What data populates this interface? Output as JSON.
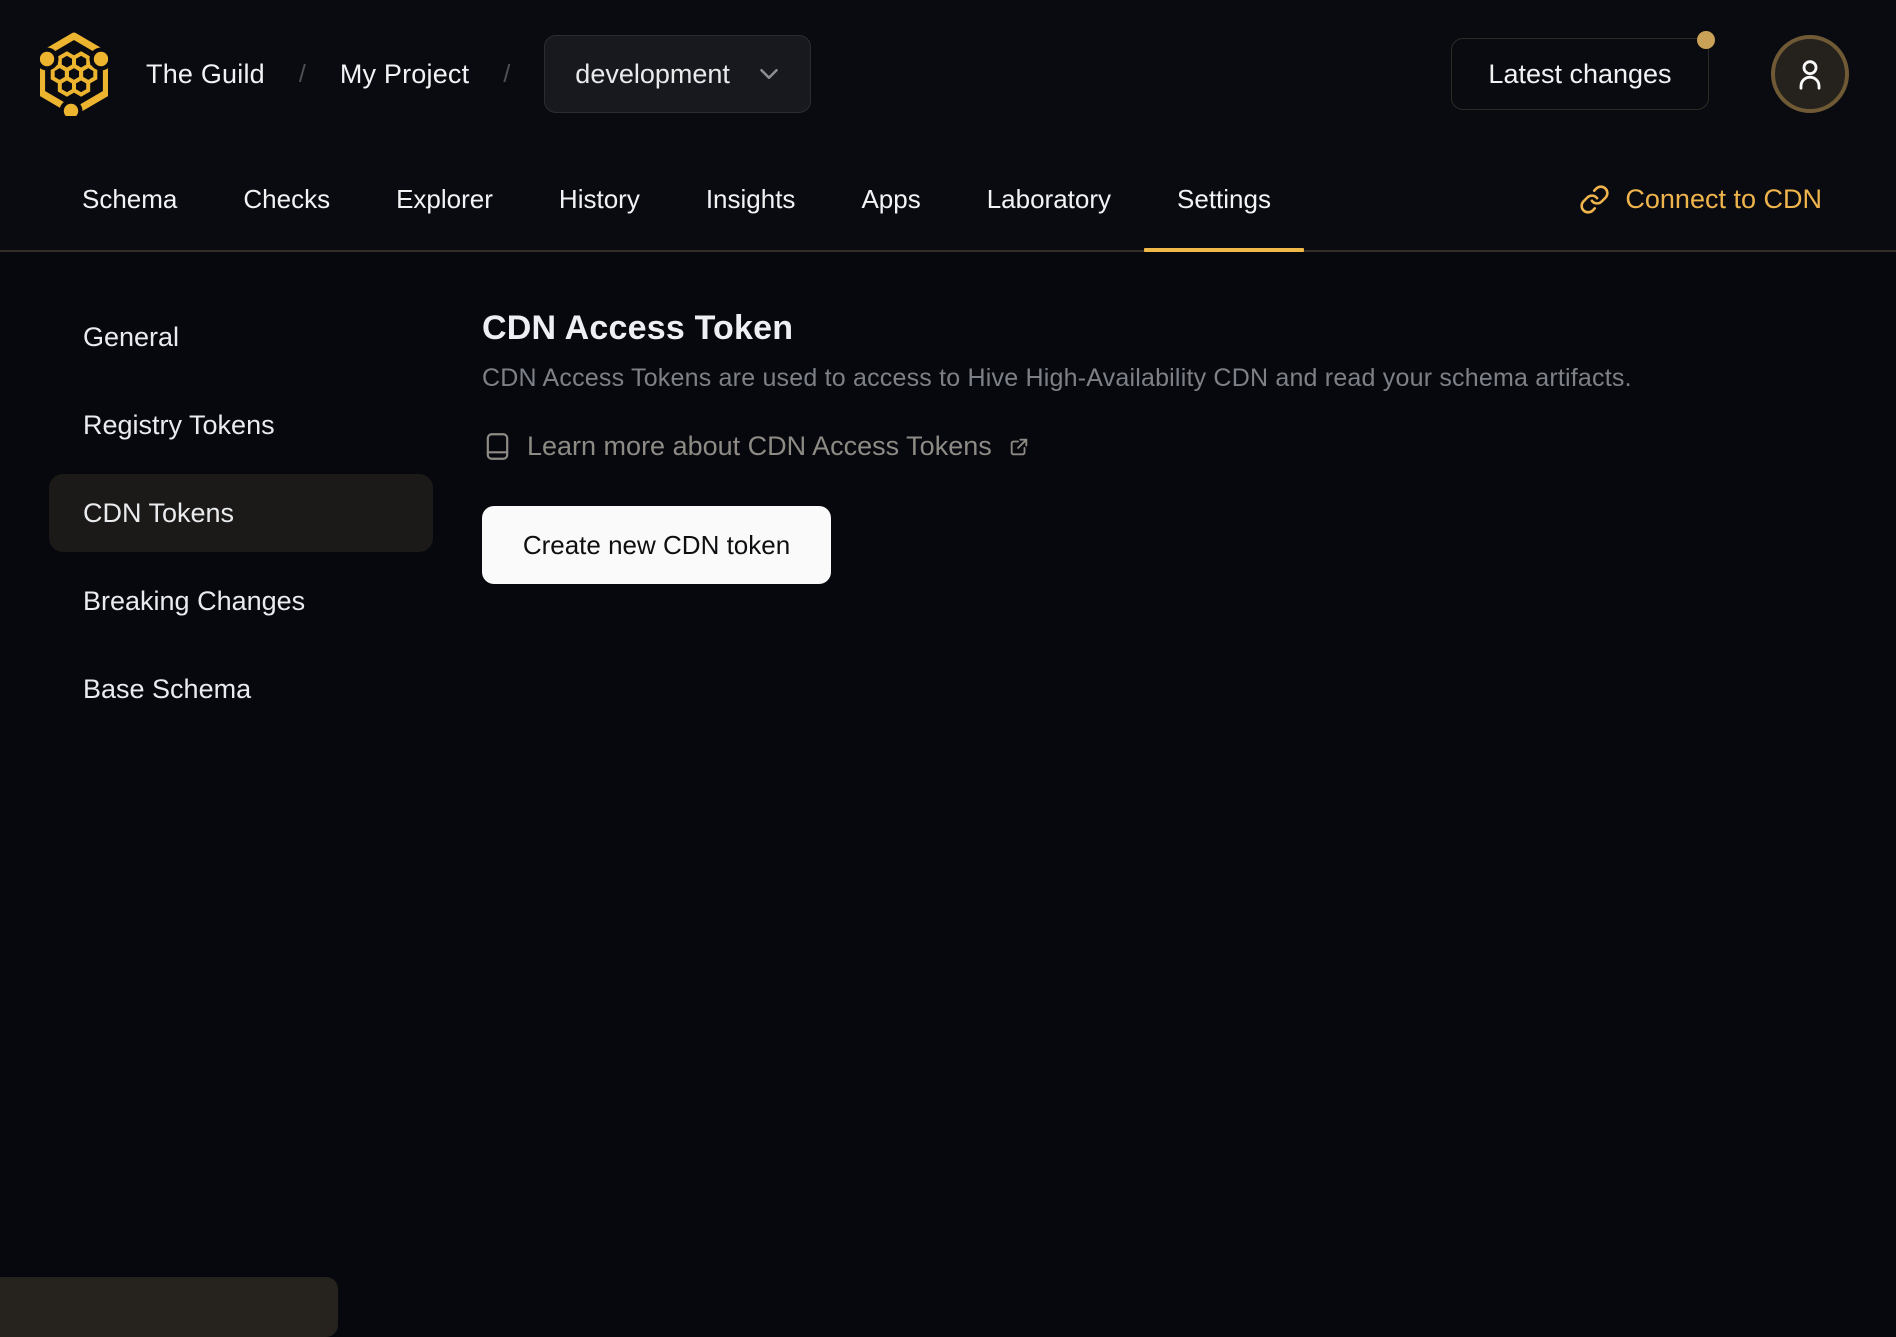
{
  "header": {
    "org": "The Guild",
    "separator": "/",
    "project": "My Project",
    "target_select": {
      "value": "development"
    },
    "latest_changes_label": "Latest changes",
    "notification_dot": true
  },
  "nav": {
    "tabs": [
      {
        "label": "Schema",
        "active": false
      },
      {
        "label": "Checks",
        "active": false
      },
      {
        "label": "Explorer",
        "active": false
      },
      {
        "label": "History",
        "active": false
      },
      {
        "label": "Insights",
        "active": false
      },
      {
        "label": "Apps",
        "active": false
      },
      {
        "label": "Laboratory",
        "active": false
      },
      {
        "label": "Settings",
        "active": true
      }
    ],
    "connect_cdn_label": "Connect to CDN"
  },
  "sidebar": {
    "items": [
      {
        "label": "General",
        "active": false
      },
      {
        "label": "Registry Tokens",
        "active": false
      },
      {
        "label": "CDN Tokens",
        "active": true
      },
      {
        "label": "Breaking Changes",
        "active": false
      },
      {
        "label": "Base Schema",
        "active": false
      }
    ]
  },
  "main": {
    "title": "CDN Access Token",
    "description": "CDN Access Tokens are used to access to Hive High-Availability CDN and read your schema artifacts.",
    "learn_more_label": "Learn more about CDN Access Tokens",
    "create_button_label": "Create new CDN token"
  },
  "icons": {
    "hive-logo": "gold hexagon with honeycomb cluster and node dots",
    "chevron-down-icon": "˅",
    "user-icon": "person outline",
    "link-icon": "chain link",
    "book-icon": "journal outline",
    "external-link-icon": "box with arrow out top-right"
  },
  "colors": {
    "background_chrome": "#090b11",
    "background_content": "#06080e",
    "accent_gold": "#efb44c",
    "tab_underline": "#efb94a",
    "logo_gold": "#ecb42f",
    "notification_dot": "#c9a257",
    "avatar_ring": "#6f5a35",
    "divider": "#322e27",
    "sidebar_active_bg": "#1b1a18",
    "select_bg": "#17191e",
    "button_bg": "#fafafa",
    "muted_text": "#7d8187",
    "link_text": "#8e8a84"
  }
}
